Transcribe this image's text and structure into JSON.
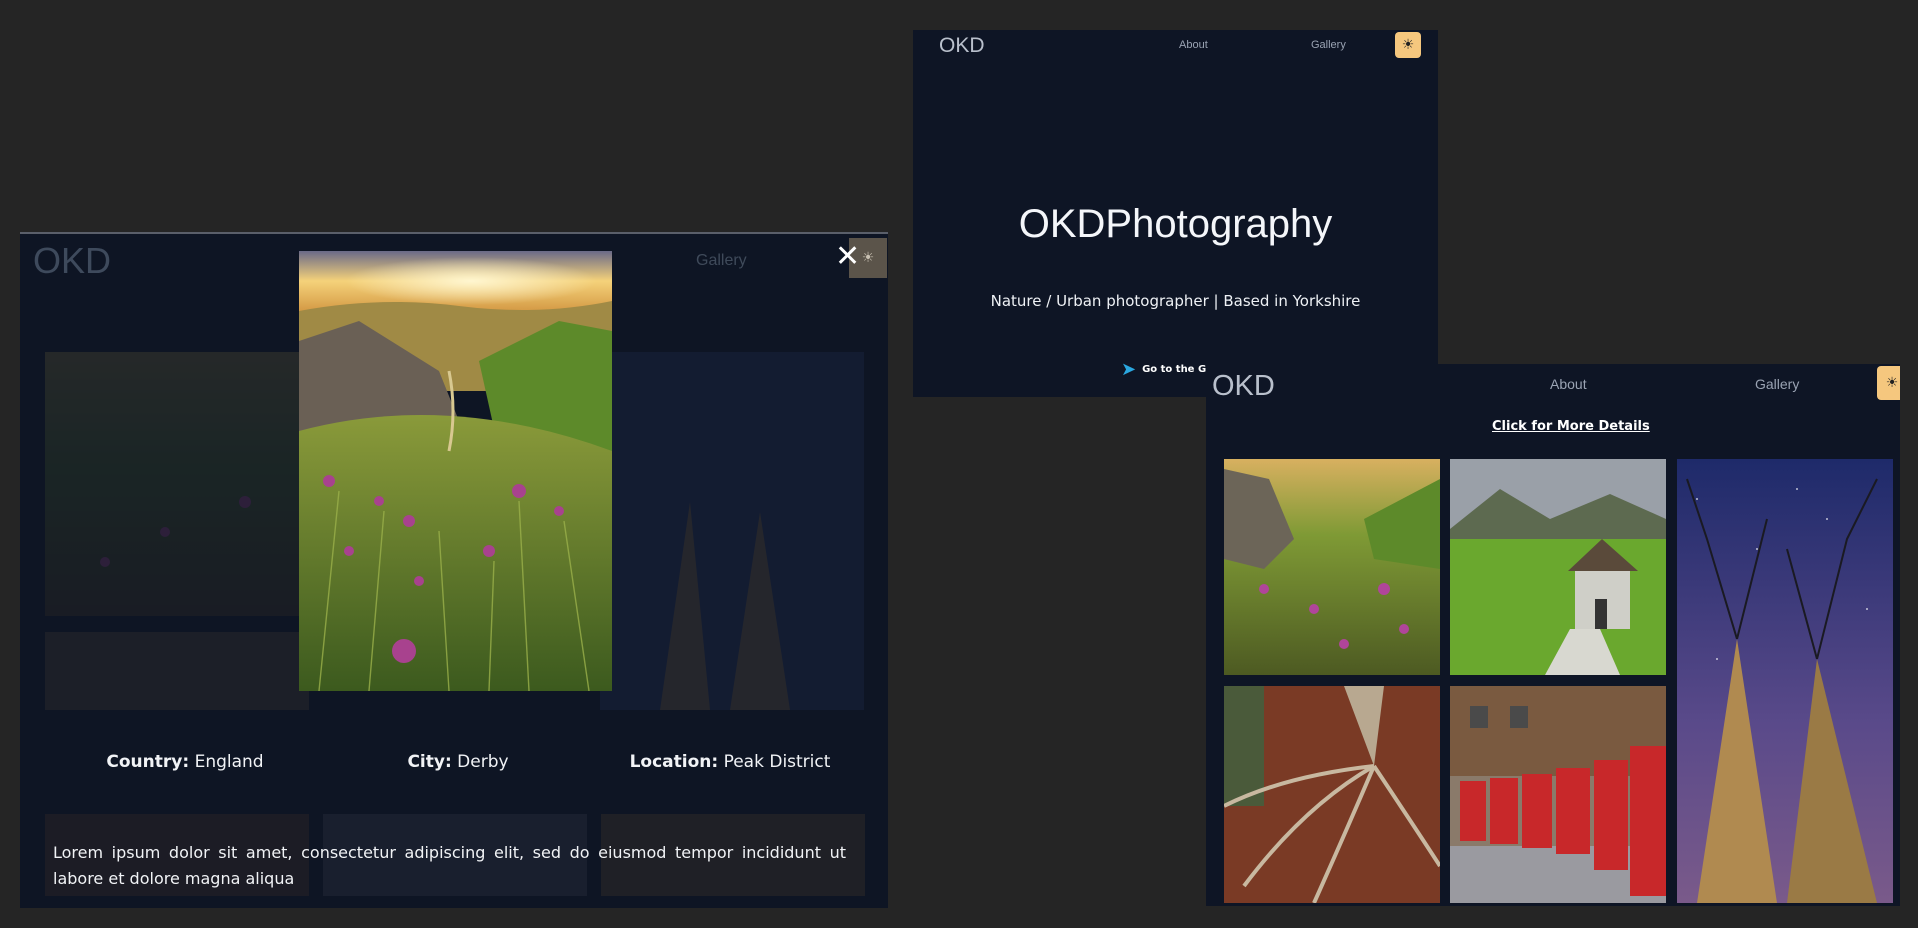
{
  "modal_view": {
    "brand": "OKD",
    "nav_gallery": "Gallery",
    "close": "✕",
    "theme_icon": "☀",
    "details": {
      "country_label": "Country:",
      "country_value": "England",
      "city_label": "City:",
      "city_value": "Derby",
      "location_label": "Location:",
      "location_value": "Peak District"
    },
    "description": "Lorem ipsum dolor sit amet, consectetur adipiscing elit, sed do eiusmod tempor incididunt ut labore et dolore magna aliqua"
  },
  "landing": {
    "brand": "OKD",
    "nav": [
      "About",
      "Gallery"
    ],
    "theme_icon": "☀",
    "title": "OKDPhotography",
    "subtitle": "Nature / Urban photographer | Based in Yorkshire",
    "cta": "Go to the Ga"
  },
  "gallery": {
    "brand": "OKD",
    "nav": [
      "About",
      "Gallery"
    ],
    "theme_icon": "☀",
    "more_details": "Click for More Details",
    "photos": [
      "thistle-valley-photo",
      "chapel-photo",
      "tree-stars-photo",
      "tree-roots-photo",
      "phone-boxes-photo"
    ]
  },
  "colors": {
    "background": "#252525",
    "frame": "#0e1525",
    "accent": "#f5c77e",
    "cta_arrow": "#2aa7e0"
  }
}
